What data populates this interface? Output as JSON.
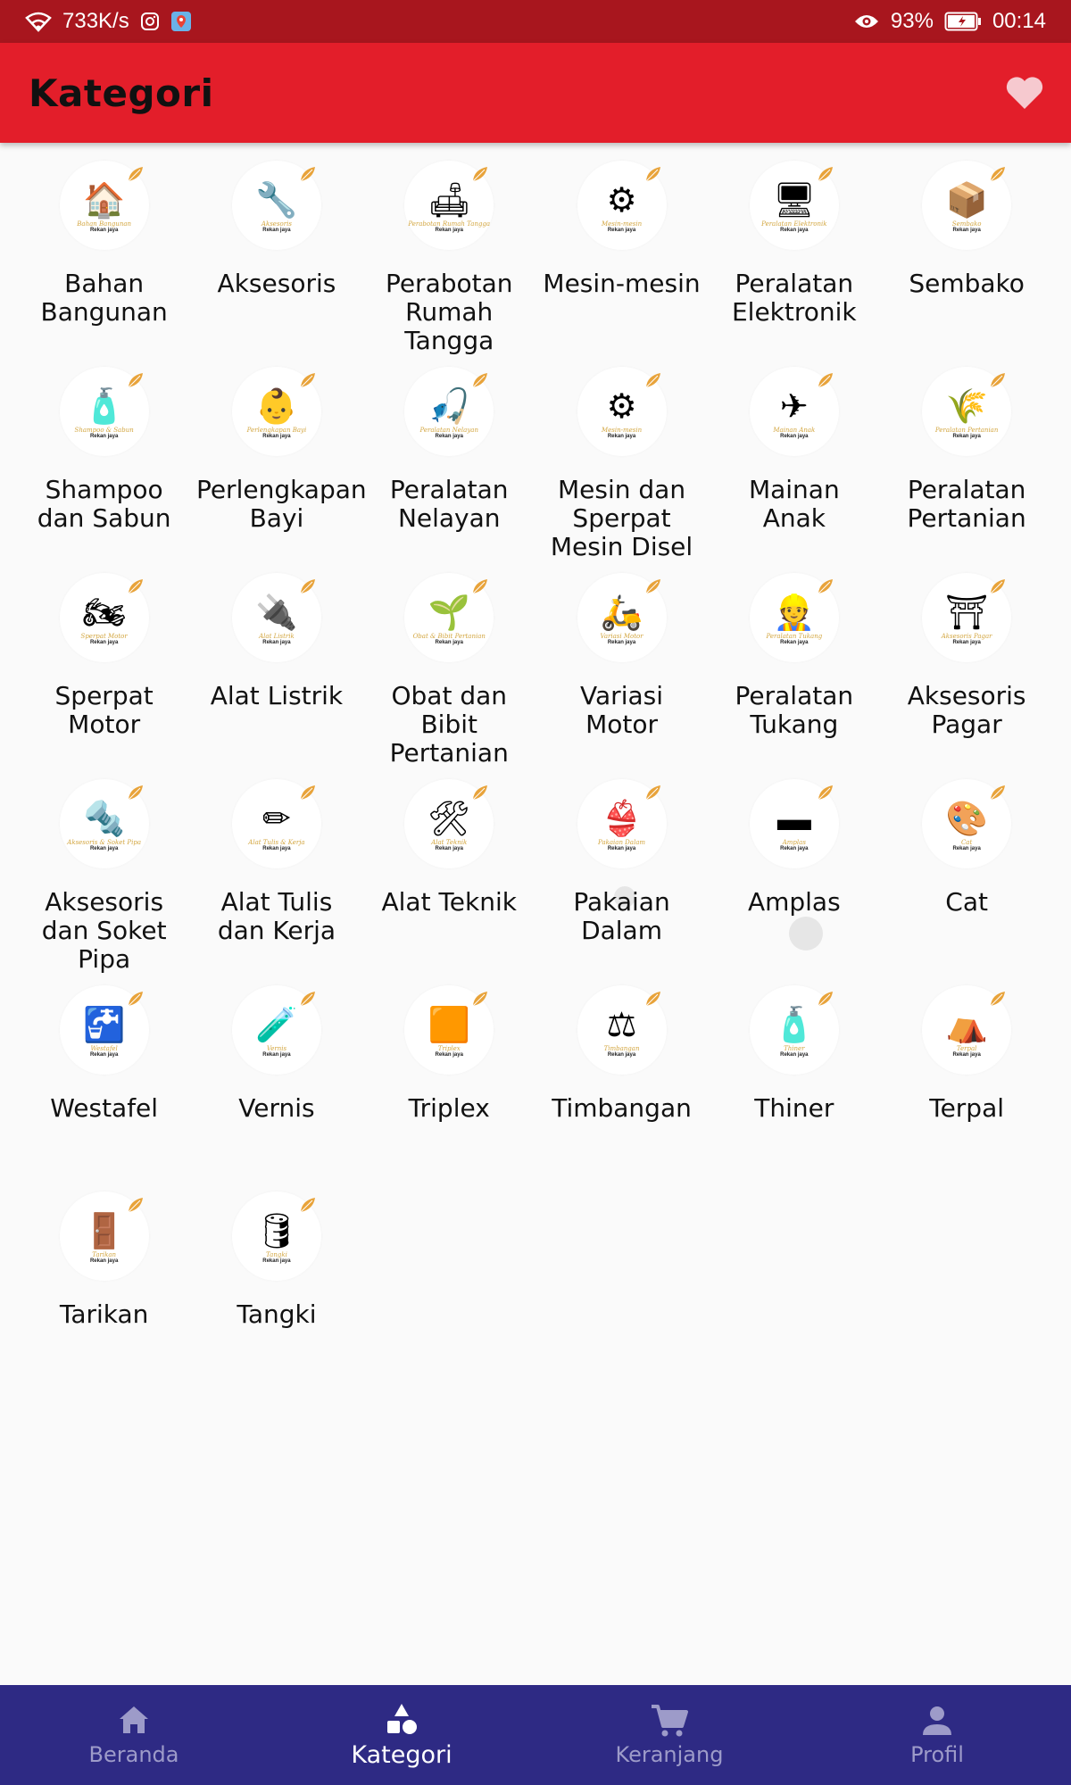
{
  "status_bar": {
    "network_speed": "733K/s",
    "battery": "93%",
    "time": "00:14",
    "icons": [
      "wifi-icon",
      "instagram-icon",
      "maps-icon",
      "eye-icon",
      "battery-icon"
    ]
  },
  "app_bar": {
    "title": "Kategori",
    "favorite_icon": "heart-icon"
  },
  "categories": [
    {
      "label": "Bahan Bangunan",
      "caption": "Bahan Bangunan",
      "icon": "house-icon",
      "glyph": "🏠"
    },
    {
      "label": "Aksesoris",
      "caption": "Aksesoris",
      "icon": "accessories-icon",
      "glyph": "🔧"
    },
    {
      "label": "Perabotan Rumah Tangga",
      "caption": "Perabotan Rumah Tangga",
      "icon": "sofa-icon",
      "glyph": "🛋"
    },
    {
      "label": "Mesin-mesin",
      "caption": "Mesin-mesin",
      "icon": "gears-icon",
      "glyph": "⚙"
    },
    {
      "label": "Peralatan Elektronik",
      "caption": "Peralatan Elektronik",
      "icon": "washing-machine-icon",
      "glyph": "🖥"
    },
    {
      "label": "Sembako",
      "caption": "Sembako",
      "icon": "grocery-box-icon",
      "glyph": "📦"
    },
    {
      "label": "Shampoo dan Sabun",
      "caption": "Shampoo & Sabun",
      "icon": "soap-icon",
      "glyph": "🧴"
    },
    {
      "label": "Perlengkapan Bayi",
      "caption": "Perlengkapan Bayi",
      "icon": "baby-icon",
      "glyph": "👶"
    },
    {
      "label": "Peralatan Nelayan",
      "caption": "Peralatan Nelayan",
      "icon": "fishing-icon",
      "glyph": "🎣"
    },
    {
      "label": "Mesin dan Sperpat Mesin Disel",
      "caption": "Mesin-mesin",
      "icon": "engine-parts-icon",
      "glyph": "⚙"
    },
    {
      "label": "Mainan Anak",
      "caption": "Mainan Anak",
      "icon": "toy-plane-icon",
      "glyph": "✈"
    },
    {
      "label": "Peralatan Pertanian",
      "caption": "Peralatan Pertanian",
      "icon": "farmer-icon",
      "glyph": "🌾"
    },
    {
      "label": "Sperpat Motor",
      "caption": "Sperpat Motor",
      "icon": "motor-parts-icon",
      "glyph": "🏍"
    },
    {
      "label": "Alat Listrik",
      "caption": "Alat Listrik",
      "icon": "electric-icon",
      "glyph": "🔌"
    },
    {
      "label": "Obat dan Bibit Pertanian",
      "caption": "Obat & Bibit Pertanian",
      "icon": "seed-icon",
      "glyph": "🌱"
    },
    {
      "label": "Variasi Motor",
      "caption": "Variasi Motor",
      "icon": "scooter-icon",
      "glyph": "🛵"
    },
    {
      "label": "Peralatan Tukang",
      "caption": "Peralatan Tukang",
      "icon": "worker-icon",
      "glyph": "👷"
    },
    {
      "label": "Aksesoris Pagar",
      "caption": "Aksesoris Pagar",
      "icon": "fence-icon",
      "glyph": "⛩"
    },
    {
      "label": "Aksesoris dan Soket Pipa",
      "caption": "Aksesoris & Soket Pipa",
      "icon": "pipe-icon",
      "glyph": "🔩"
    },
    {
      "label": "Alat Tulis dan Kerja",
      "caption": "Alat Tulis & Kerja",
      "icon": "stationery-icon",
      "glyph": "✏"
    },
    {
      "label": "Alat Teknik",
      "caption": "Alat Teknik",
      "icon": "tools-icon",
      "glyph": "🛠"
    },
    {
      "label": "Pakaian Dalam",
      "caption": "Pakaian Dalam",
      "icon": "underwear-icon",
      "glyph": "👙"
    },
    {
      "label": "Amplas",
      "caption": "Amplas",
      "icon": "sandpaper-icon",
      "glyph": "▬"
    },
    {
      "label": "Cat",
      "caption": "Cat",
      "icon": "painter-icon",
      "glyph": "🎨"
    },
    {
      "label": "Westafel",
      "caption": "Westafel",
      "icon": "sink-icon",
      "glyph": "🚰"
    },
    {
      "label": "Vernis",
      "caption": "Vernis",
      "icon": "varnish-icon",
      "glyph": "🧪"
    },
    {
      "label": "Triplex",
      "caption": "Triplex",
      "icon": "plywood-icon",
      "glyph": "🟧"
    },
    {
      "label": "Timbangan",
      "caption": "Timbangan",
      "icon": "scale-icon",
      "glyph": "⚖"
    },
    {
      "label": "Thiner",
      "caption": "Thiner",
      "icon": "bottle-icon",
      "glyph": "🧴"
    },
    {
      "label": "Terpal",
      "caption": "Terpal",
      "icon": "tent-icon",
      "glyph": "⛺"
    },
    {
      "label": "Tarikan",
      "caption": "Tarikan",
      "icon": "door-handle-icon",
      "glyph": "🚪"
    },
    {
      "label": "Tangki",
      "caption": "Tangki",
      "icon": "water-tank-icon",
      "glyph": "🛢"
    }
  ],
  "brand_caption": "Rekan jaya",
  "bottom_nav": [
    {
      "label": "Beranda",
      "icon": "home-icon",
      "active": false
    },
    {
      "label": "Kategori",
      "icon": "category-icon",
      "active": true
    },
    {
      "label": "Keranjang",
      "icon": "cart-icon",
      "active": false
    },
    {
      "label": "Profil",
      "icon": "person-icon",
      "active": false
    }
  ],
  "colors": {
    "status_bar": "#a8161e",
    "app_bar": "#e31e2a",
    "bottom_nav": "#2e2a84",
    "nav_active": "#ffffff",
    "nav_inactive": "#9d9bc9",
    "heart": "#f6c9cf"
  }
}
